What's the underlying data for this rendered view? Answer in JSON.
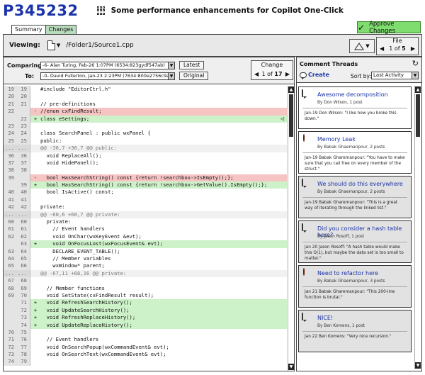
{
  "header": {
    "id": "P345232",
    "title": "Some performance enhancements for Copilot One-Click"
  },
  "tabs": [
    {
      "label": "Summary"
    },
    {
      "label": "Changes"
    }
  ],
  "approve": {
    "label": "Approve Changes"
  },
  "toolbar": {
    "viewing_label": "Viewing:",
    "file_path": "/Folder1/Source1.cpp",
    "file_nav": {
      "title": "File",
      "current": "1",
      "of_label": "of",
      "total": "5"
    }
  },
  "compare": {
    "comparing_label": "Comparing:",
    "to_label": "To:",
    "from_value": "-6- Alan Turing, Feb-26 1:07PM (6534:823gydf547ab)",
    "to_value": "-0- David Fullerton, Jan-23 2:23PM (7634:800e2756c9ab)",
    "latest_label": "Latest",
    "original_label": "Original",
    "change_nav": {
      "title": "Change",
      "current": "1",
      "of_label": "of",
      "total": "17"
    }
  },
  "diff_lines": [
    {
      "kind": "ctx",
      "old": "19",
      "new": "19",
      "mark": "",
      "text": "#include \"EditorCtrl.h\""
    },
    {
      "kind": "ctx",
      "old": "20",
      "new": "20",
      "mark": "",
      "text": ""
    },
    {
      "kind": "ctx",
      "old": "21",
      "new": "21",
      "mark": "",
      "text": "// pre-definitions"
    },
    {
      "kind": "del",
      "old": "22",
      "new": "",
      "mark": "-",
      "text": "//enum cxFindResult;"
    },
    {
      "kind": "add",
      "old": "",
      "new": "22",
      "mark": "+",
      "text": "class eSettings;"
    },
    {
      "kind": "ctx",
      "old": "23",
      "new": "23",
      "mark": "",
      "text": ""
    },
    {
      "kind": "ctx",
      "old": "24",
      "new": "24",
      "mark": "",
      "text": "class SearchPanel : public wxPanel {"
    },
    {
      "kind": "ctx",
      "old": "25",
      "new": "25",
      "mark": "",
      "text": "public:"
    },
    {
      "kind": "hunk",
      "old": "...",
      "new": "...",
      "mark": "",
      "text": "@@ -36,7 +36,7 @@ public:"
    },
    {
      "kind": "ctx",
      "old": "36",
      "new": "36",
      "mark": "",
      "text": "  void ReplaceAll();"
    },
    {
      "kind": "ctx",
      "old": "37",
      "new": "37",
      "mark": "",
      "text": "  void HidePanel();"
    },
    {
      "kind": "ctx",
      "old": "38",
      "new": "38",
      "mark": "",
      "text": ""
    },
    {
      "kind": "del",
      "old": "39",
      "new": "",
      "mark": "-",
      "text": "  bool HasSearchString() const {return !searchbox->IsEmpty();};"
    },
    {
      "kind": "add",
      "old": "",
      "new": "39",
      "mark": "+",
      "text": "  bool HasSearchString() const {return !searchbox->GetValue().IsEmpty();};"
    },
    {
      "kind": "ctx",
      "old": "40",
      "new": "40",
      "mark": "",
      "text": "  bool IsActive() const;"
    },
    {
      "kind": "ctx",
      "old": "41",
      "new": "41",
      "mark": "",
      "text": ""
    },
    {
      "kind": "ctx",
      "old": "42",
      "new": "42",
      "mark": "",
      "text": "private:"
    },
    {
      "kind": "hunk",
      "old": "...",
      "new": "...",
      "mark": "",
      "text": "@@ -60,6 +60,7 @@ private:"
    },
    {
      "kind": "ctx",
      "old": "60",
      "new": "60",
      "mark": "",
      "text": "  private:"
    },
    {
      "kind": "ctx",
      "old": "61",
      "new": "61",
      "mark": "",
      "text": "    // Event handlers"
    },
    {
      "kind": "ctx",
      "old": "62",
      "new": "62",
      "mark": "",
      "text": "    void OnChar(wxKeyEvent &evt);"
    },
    {
      "kind": "add",
      "old": "",
      "new": "63",
      "mark": "+",
      "text": "    void OnFocusLost(wxFocusEvent& evt);"
    },
    {
      "kind": "ctx",
      "old": "63",
      "new": "64",
      "mark": "",
      "text": "    DECLARE_EVENT_TABLE();"
    },
    {
      "kind": "ctx",
      "old": "64",
      "new": "65",
      "mark": "",
      "text": "    // Member variables"
    },
    {
      "kind": "ctx",
      "old": "65",
      "new": "66",
      "mark": "",
      "text": "    wxWindow* parent;"
    },
    {
      "kind": "hunk",
      "old": "...",
      "new": "...",
      "mark": "",
      "text": "@@ -67,11 +68,16 @@ private:"
    },
    {
      "kind": "ctx",
      "old": "67",
      "new": "68",
      "mark": "",
      "text": ""
    },
    {
      "kind": "ctx",
      "old": "68",
      "new": "69",
      "mark": "",
      "text": "  // Member functions"
    },
    {
      "kind": "ctx",
      "old": "69",
      "new": "70",
      "mark": "",
      "text": "  void SetState(cxFindResult result);"
    },
    {
      "kind": "add",
      "old": "",
      "new": "71",
      "mark": "+",
      "text": "  void RefreshSearchHistory();"
    },
    {
      "kind": "add",
      "old": "",
      "new": "72",
      "mark": "+",
      "text": "  void UpdateSearchHistory();"
    },
    {
      "kind": "add",
      "old": "",
      "new": "73",
      "mark": "+",
      "text": "  void RefreshReplaceHistory();"
    },
    {
      "kind": "add",
      "old": "",
      "new": "74",
      "mark": "+",
      "text": "  void UpdateReplaceHistory();"
    },
    {
      "kind": "ctx",
      "old": "70",
      "new": "75",
      "mark": "",
      "text": ""
    },
    {
      "kind": "ctx",
      "old": "71",
      "new": "76",
      "mark": "",
      "text": "  // Event handlers"
    },
    {
      "kind": "ctx",
      "old": "72",
      "new": "77",
      "mark": "",
      "text": "  void OnSearchPopup(wxCommandEvent& evt);"
    },
    {
      "kind": "ctx",
      "old": "73",
      "new": "78",
      "mark": "",
      "text": "  void OnSearchText(wxCommandEvent& evt);"
    },
    {
      "kind": "ctx",
      "old": "74",
      "new": "79",
      "mark": "",
      "text": ""
    }
  ],
  "comments": {
    "title": "Comment Threads",
    "create_label": "Create",
    "sort_label": "Sort by:",
    "sort_value": "Last Activity",
    "threads": [
      {
        "icon": "comment-bubble-icon",
        "grey": false,
        "title": "Awesome decomposition",
        "byline": "By Don Wilson, 1 post",
        "last": "Jan-19 Don Wilson: \"I like how you broke this down.\""
      },
      {
        "icon": "bug-icon",
        "grey": false,
        "title": "Memory Leak",
        "byline": "By Babak Ghaemanpour, 2 posts",
        "last": "Jan-19 Babak Gharemanpour: \"You have to make sure that you call free on every member of the struct.\""
      },
      {
        "icon": "comment-bubble-icon",
        "grey": true,
        "title": "We should do this everywhere",
        "byline": "By Babak Ghaemanpour, 2 posts",
        "last": "Jan-19 Babak Gharemanpour: \"This is a great way of iterating through the linked list.\""
      },
      {
        "icon": "comment-bubble-icon",
        "grey": true,
        "title": "Did you consider a hash table here?",
        "byline": "By Jason Rosoff, 1 post",
        "last": "Jan 20 Jason Rosoff: \"A hash table would make this O(1), but maybe the data set is too small to matter.\""
      },
      {
        "icon": "bug-icon",
        "grey": true,
        "title": "Need to refactor here",
        "byline": "By Babak Ghaemanpour, 3 posts",
        "last": "Jan 21 Babak Gharemanpour: \"This 200-line function is brutal.\""
      },
      {
        "icon": "comment-bubble-icon",
        "grey": true,
        "title": "NICE!",
        "byline": "By Ben Komens, 1 post",
        "last": "Jan 22 Ben Komens: \"Very nice recursion.\""
      }
    ]
  }
}
